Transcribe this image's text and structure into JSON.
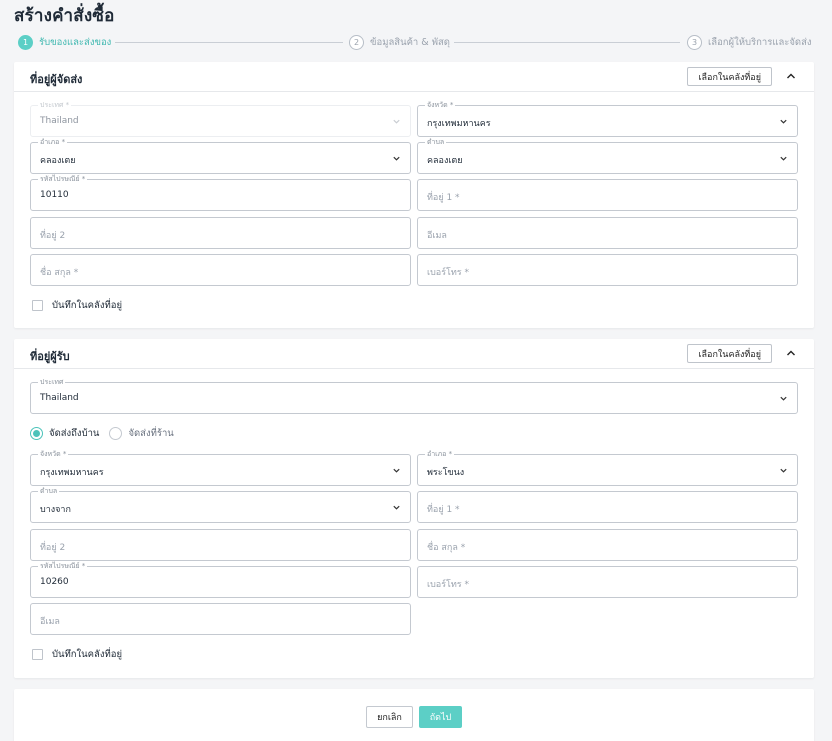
{
  "page": {
    "title": "สร้างคำสั่งซื้อ"
  },
  "colors": {
    "accent": "#5ccfc6",
    "border": "#c4c9d0",
    "background": "#f4f5f7"
  },
  "stepper": {
    "steps": [
      {
        "number": "1",
        "label": "รับของและส่งของ",
        "active": true
      },
      {
        "number": "2",
        "label": "ข้อมูลสินค้า & พัสดุ",
        "active": false
      },
      {
        "number": "3",
        "label": "เลือกผู้ให้บริการและจัดส่ง",
        "active": false
      }
    ]
  },
  "sender": {
    "title": "ที่อยู่ผู้จัดส่ง",
    "pick_button": "เลือกในคลังที่อยู่",
    "collapse_icon": "chevron-up-icon",
    "fields": {
      "country": {
        "label": "ประเทศ *",
        "value": "Thailand"
      },
      "province": {
        "label": "จังหวัด *",
        "value": "กรุงเทพมหานคร"
      },
      "district": {
        "label": "อำเภอ *",
        "value": "คลองเตย"
      },
      "subdistrict": {
        "label": "ตำบล",
        "value": "คลองเตย"
      },
      "postcode": {
        "label": "รหัสไปรษณีย์ *",
        "value": "10110"
      },
      "address1": {
        "placeholder": "ที่อยู่ 1 *"
      },
      "address2": {
        "placeholder": "ที่อยู่ 2"
      },
      "email": {
        "placeholder": "อีเมล"
      },
      "name": {
        "placeholder": "ชื่อ สกุล *"
      },
      "phone": {
        "placeholder": "เบอร์โทร *"
      }
    },
    "save_label": "บันทึกในคลังที่อยู่"
  },
  "receiver": {
    "title": "ที่อยู่ผู้รับ",
    "pick_button": "เลือกในคลังที่อยู่",
    "collapse_icon": "chevron-up-icon",
    "delivery": {
      "home_label": "จัดส่งถึงบ้าน",
      "store_label": "จัดส่งที่ร้าน",
      "selected": "home"
    },
    "fields": {
      "country": {
        "label": "ประเทศ",
        "value": "Thailand"
      },
      "province": {
        "label": "จังหวัด *",
        "value": "กรุงเทพมหานคร"
      },
      "district": {
        "label": "อำเภอ *",
        "value": "พระโขนง"
      },
      "subdistrict": {
        "label": "ตำบล",
        "value": "บางจาก"
      },
      "address1": {
        "placeholder": "ที่อยู่ 1 *"
      },
      "address2": {
        "placeholder": "ที่อยู่ 2"
      },
      "name": {
        "placeholder": "ชื่อ สกุล *"
      },
      "postcode": {
        "label": "รหัสไปรษณีย์ *",
        "value": "10260"
      },
      "phone": {
        "placeholder": "เบอร์โทร *"
      },
      "email": {
        "placeholder": "อีเมล"
      }
    },
    "save_label": "บันทึกในคลังที่อยู่"
  },
  "footer": {
    "cancel_label": "ยกเลิก",
    "next_label": "ถัดไป"
  }
}
